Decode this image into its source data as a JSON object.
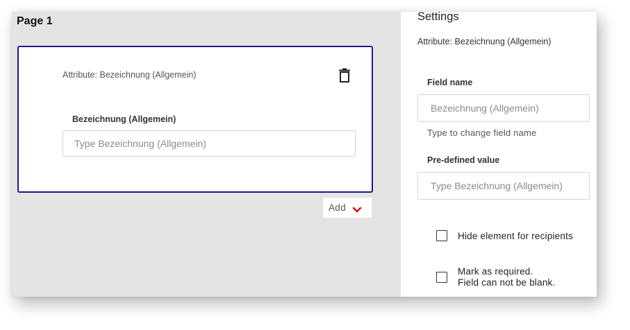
{
  "canvas": {
    "page_title": "Page 1",
    "card": {
      "attribute_text": "Attribute: Bezeichnung (Allgemein)",
      "field_label": "Bezeichnung (Allgemein)",
      "field_placeholder": "Type Bezeichnung (Allgemein)",
      "delete_icon": "trash-icon"
    },
    "add_button": {
      "label": "Add",
      "icon": "chevron-down-icon",
      "icon_color": "#d0021b"
    }
  },
  "settings": {
    "title": "Settings",
    "attribute_text": "Attribute: Bezeichnung (Allgemein)",
    "field_name": {
      "label": "Field name",
      "value": "",
      "placeholder": "Bezeichnung (Allgemein)",
      "helper": "Type to change field name"
    },
    "predefined_value": {
      "label": "Pre-defined value",
      "value": "",
      "placeholder": "Type Bezeichnung (Allgemein)"
    },
    "hide_element": {
      "label": "Hide element for recipients",
      "checked": false
    },
    "required": {
      "line1": "Mark as required.",
      "line2": "Field can not be blank.",
      "checked": false
    }
  },
  "colors": {
    "card_border": "#1a1a8c",
    "canvas_bg": "#e4e4e4",
    "accent_red": "#d0021b"
  }
}
